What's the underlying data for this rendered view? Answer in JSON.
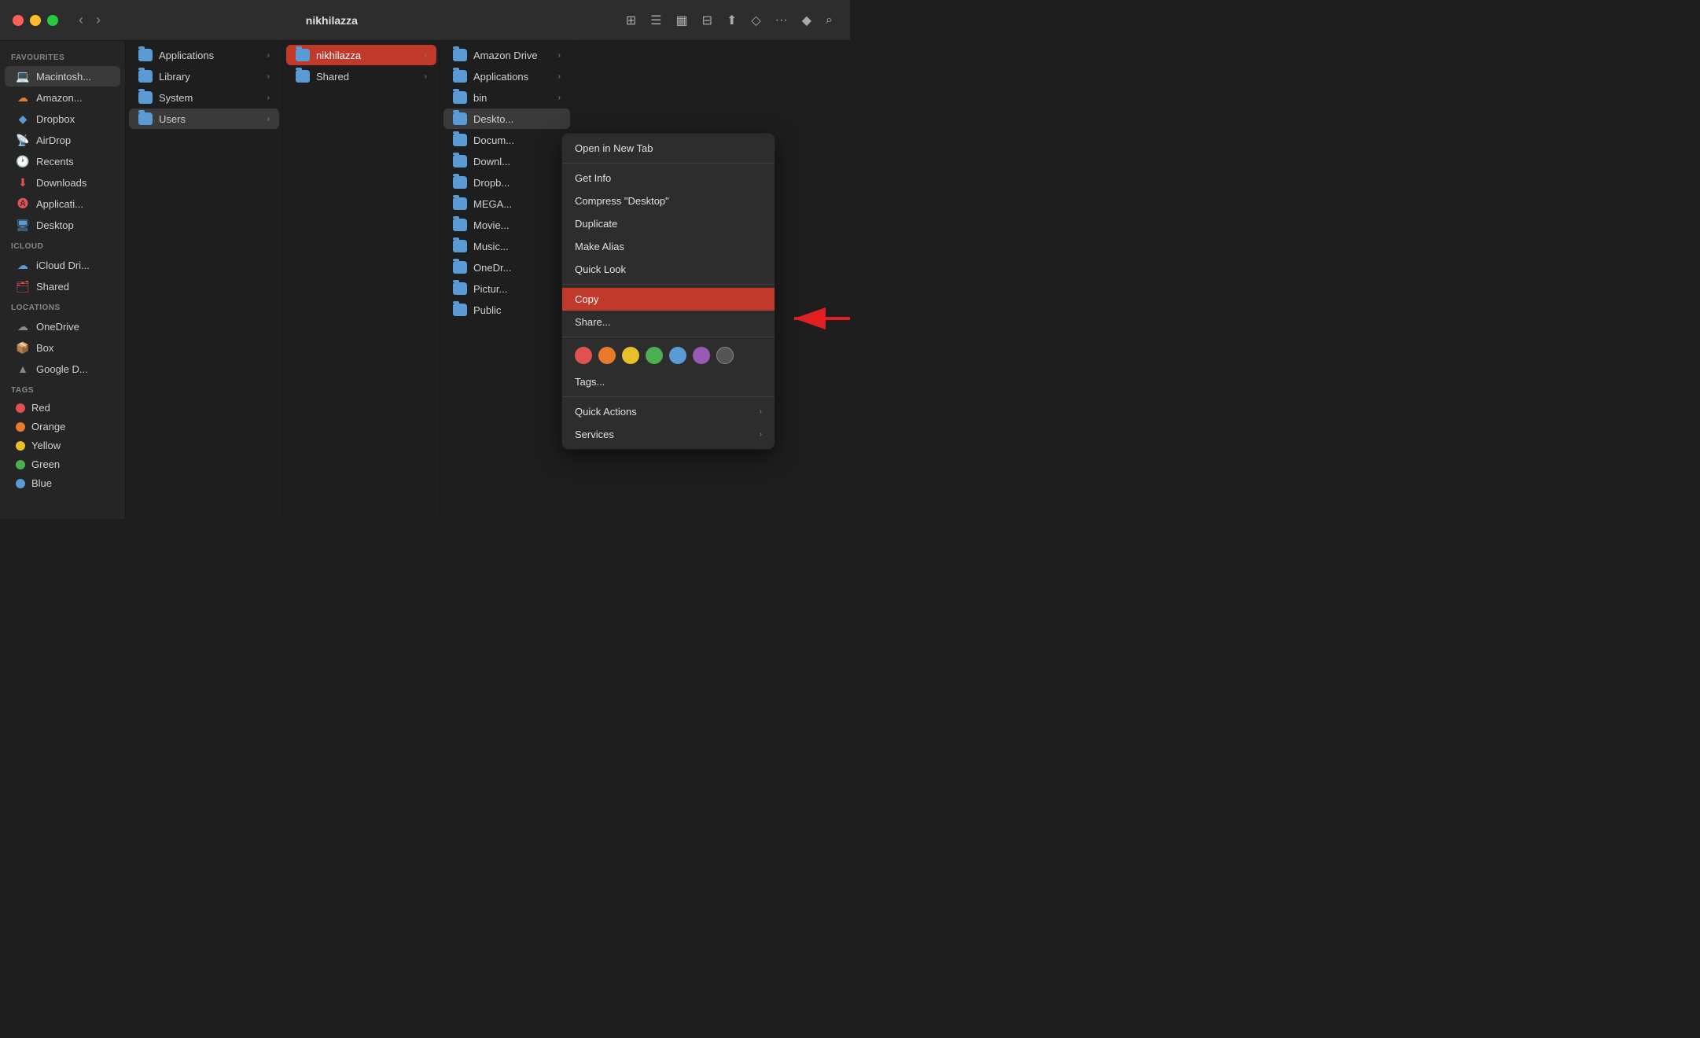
{
  "titlebar": {
    "title": "nikhilazza",
    "back_label": "‹",
    "forward_label": "›"
  },
  "sidebar": {
    "sections": [
      {
        "label": "Favourites",
        "items": [
          {
            "id": "macintosh",
            "text": "Macintosh...",
            "icon": "💻",
            "icon_class": "red"
          },
          {
            "id": "amazon",
            "text": "Amazon...",
            "icon": "☁",
            "icon_class": "orange"
          },
          {
            "id": "dropbox",
            "text": "Dropbox",
            "icon": "◆",
            "icon_class": "blue"
          },
          {
            "id": "airdrop",
            "text": "AirDrop",
            "icon": "📡",
            "icon_class": "blue"
          },
          {
            "id": "recents",
            "text": "Recents",
            "icon": "🕐",
            "icon_class": "red"
          },
          {
            "id": "downloads",
            "text": "Downloads",
            "icon": "⬇",
            "icon_class": "red"
          },
          {
            "id": "applications",
            "text": "Applicati...",
            "icon": "🅰",
            "icon_class": "red"
          },
          {
            "id": "desktop",
            "text": "Desktop",
            "icon": "🖥",
            "icon_class": "blue"
          }
        ]
      },
      {
        "label": "iCloud",
        "items": [
          {
            "id": "icloud-drive",
            "text": "iCloud Dri...",
            "icon": "☁",
            "icon_class": "blue"
          },
          {
            "id": "shared",
            "text": "Shared",
            "icon": "🗂",
            "icon_class": "red"
          }
        ]
      },
      {
        "label": "Locations",
        "items": [
          {
            "id": "onedrive",
            "text": "OneDrive",
            "icon": "☁",
            "icon_class": "gray"
          },
          {
            "id": "box",
            "text": "Box",
            "icon": "📦",
            "icon_class": "gray"
          },
          {
            "id": "google-drive",
            "text": "Google D...",
            "icon": "▲",
            "icon_class": "gray"
          }
        ]
      },
      {
        "label": "Tags",
        "tags": [
          {
            "id": "red",
            "text": "Red",
            "color": "#e05252"
          },
          {
            "id": "orange",
            "text": "Orange",
            "color": "#e87b2a"
          },
          {
            "id": "yellow",
            "text": "Yellow",
            "color": "#e8c12a"
          },
          {
            "id": "green",
            "text": "Green",
            "color": "#4caf50"
          },
          {
            "id": "blue",
            "text": "Blue",
            "color": "#5b9bd5"
          }
        ]
      }
    ]
  },
  "columns": [
    {
      "id": "col1",
      "items": [
        {
          "id": "applications",
          "text": "Applications",
          "has_arrow": true
        },
        {
          "id": "library",
          "text": "Library",
          "has_arrow": true
        },
        {
          "id": "system",
          "text": "System",
          "has_arrow": true
        },
        {
          "id": "users",
          "text": "Users",
          "has_arrow": true,
          "selected": true
        }
      ]
    },
    {
      "id": "col2",
      "items": [
        {
          "id": "nikhilazza",
          "text": "nikhilazza",
          "has_arrow": true,
          "selected": true
        },
        {
          "id": "shared",
          "text": "Shared",
          "has_arrow": true
        }
      ]
    },
    {
      "id": "col3",
      "items": [
        {
          "id": "amazon-drive",
          "text": "Amazon Drive",
          "has_arrow": true
        },
        {
          "id": "applications",
          "text": "Applications",
          "has_arrow": true
        },
        {
          "id": "bin",
          "text": "bin",
          "has_arrow": true
        },
        {
          "id": "desktop",
          "text": "Deskto...",
          "has_arrow": false,
          "selected_blue": true
        },
        {
          "id": "documents",
          "text": "Docum...",
          "has_arrow": false
        },
        {
          "id": "downloads",
          "text": "Downl...",
          "has_arrow": false
        },
        {
          "id": "dropbox",
          "text": "Dropb...",
          "has_arrow": false
        },
        {
          "id": "mega",
          "text": "MEGA...",
          "has_arrow": false
        },
        {
          "id": "movies",
          "text": "Movie...",
          "has_arrow": false
        },
        {
          "id": "music",
          "text": "Music...",
          "has_arrow": false
        },
        {
          "id": "onedrive",
          "text": "OneDr...",
          "has_arrow": false
        },
        {
          "id": "pictures",
          "text": "Pictur...",
          "has_arrow": false
        },
        {
          "id": "public",
          "text": "Public",
          "has_arrow": false
        }
      ]
    }
  ],
  "context_menu": {
    "items": [
      {
        "id": "open-new-tab",
        "text": "Open in New Tab",
        "has_arrow": false
      },
      {
        "id": "divider1",
        "type": "divider"
      },
      {
        "id": "get-info",
        "text": "Get Info",
        "has_arrow": false
      },
      {
        "id": "compress",
        "text": "Compress \"Desktop\"",
        "has_arrow": false
      },
      {
        "id": "duplicate",
        "text": "Duplicate",
        "has_arrow": false
      },
      {
        "id": "make-alias",
        "text": "Make Alias",
        "has_arrow": false
      },
      {
        "id": "quick-look",
        "text": "Quick Look",
        "has_arrow": false
      },
      {
        "id": "divider2",
        "type": "divider"
      },
      {
        "id": "copy",
        "text": "Copy",
        "has_arrow": false,
        "highlighted": true
      },
      {
        "id": "share",
        "text": "Share...",
        "has_arrow": false
      },
      {
        "id": "divider3",
        "type": "divider"
      },
      {
        "id": "tags-row",
        "type": "tags"
      },
      {
        "id": "tags",
        "text": "Tags...",
        "has_arrow": false
      },
      {
        "id": "divider4",
        "type": "divider"
      },
      {
        "id": "quick-actions",
        "text": "Quick Actions",
        "has_arrow": true
      },
      {
        "id": "services",
        "text": "Services",
        "has_arrow": true
      }
    ],
    "tags": [
      {
        "color": "#e05252"
      },
      {
        "color": "#e87b2a"
      },
      {
        "color": "#e8c12a"
      },
      {
        "color": "#4caf50"
      },
      {
        "color": "#5b9bd5"
      },
      {
        "color": "#9b59b6"
      },
      {
        "color": "#555"
      }
    ]
  }
}
